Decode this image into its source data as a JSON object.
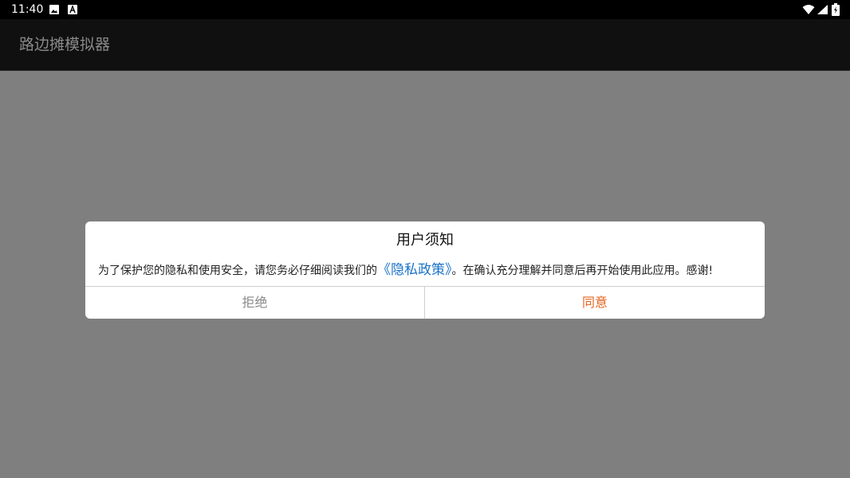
{
  "status_bar": {
    "time": "11:40",
    "notification_icons": [
      "image-icon",
      "a-app-icon"
    ],
    "system_icons": [
      "wifi-icon",
      "signal-icon",
      "battery-icon"
    ]
  },
  "app_bar": {
    "title": "路边摊模拟器"
  },
  "dialog": {
    "title": "用户须知",
    "message_before": "为了保护您的隐私和使用安全，请您务必仔细阅读我们的",
    "policy_link": "《隐私政策》",
    "message_after": "。在确认充分理解并同意后再开始使用此应用。感谢!",
    "reject_label": "拒绝",
    "agree_label": "同意"
  },
  "colors": {
    "scrim": "#7f7f7f",
    "app_bar_bg": "#101010",
    "link": "#1a73c8",
    "agree": "#e5641f",
    "reject": "#8a8a8a"
  }
}
